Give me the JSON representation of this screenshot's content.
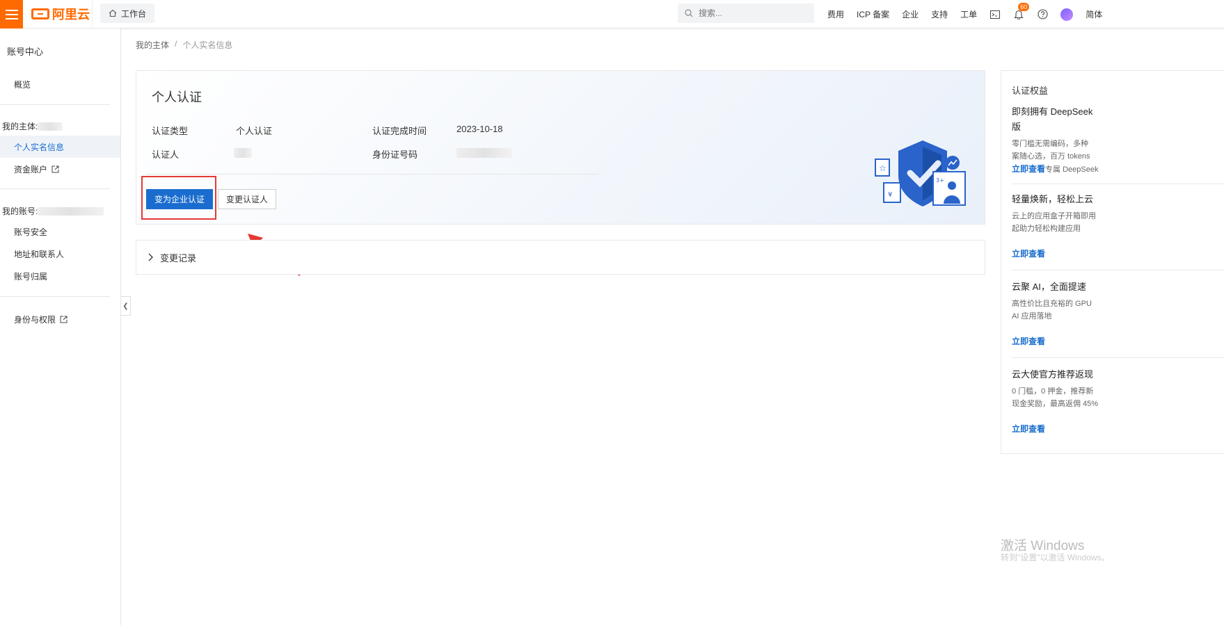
{
  "topbar": {
    "logo_text": "阿里云",
    "workbench_label": "工作台",
    "search_placeholder": "搜索...",
    "nav": [
      "费用",
      "ICP 备案",
      "企业",
      "支持",
      "工单"
    ],
    "notification_count": "60",
    "lang": "简体"
  },
  "sidebar": {
    "title": "账号中心",
    "overview": "概览",
    "entity_group_label": "我的主体:",
    "real_name_info": "个人实名信息",
    "fund_account": "资金账户",
    "account_group_label": "我的账号:",
    "account_security": "账号安全",
    "address_contacts": "地址和联系人",
    "account_ownership": "账号归属",
    "identity_permissions": "身份与权限"
  },
  "breadcrumb": {
    "root": "我的主体",
    "separator": "/",
    "current": "个人实名信息"
  },
  "card": {
    "title": "个人认证",
    "type_label": "认证类型",
    "type_value": "个人认证",
    "completed_label": "认证完成时间",
    "completed_value": "2023-10-18",
    "person_label": "认证人",
    "id_label": "身份证号码",
    "primary_button": "变为企业认证",
    "secondary_button": "变更认证人"
  },
  "records": {
    "label": "变更记录"
  },
  "right_panel": {
    "title": "认证权益",
    "promos": [
      {
        "title_line1": "即刻拥有 DeepSeek",
        "title_line2": "版",
        "desc_line1": "零门槛无需编码，多种",
        "desc_line2": "案随心选，百万 tokens",
        "link": "立即查看",
        "link_suffix": "专属 DeepSeek"
      },
      {
        "title_line1": "轻量焕新，轻松上云",
        "desc_line1": "云上的应用盒子开箱即用",
        "desc_line2": "起助力轻松构建应用",
        "link": "立即查看"
      },
      {
        "title_line1": "云聚 AI，全面提速",
        "desc_line1": "高性价比且充裕的 GPU",
        "desc_line2": "AI 应用落地",
        "link": "立即查看"
      },
      {
        "title_line1": "云大使官方推荐返现",
        "desc_line1": "0 门槛，0 押金，推荐新",
        "desc_line2": "现金奖励，最高返佣 45%",
        "link": "立即查看"
      }
    ]
  },
  "watermark": {
    "line1": "激活 Windows",
    "line2": "转到\"设置\"以激活 Windows。"
  }
}
